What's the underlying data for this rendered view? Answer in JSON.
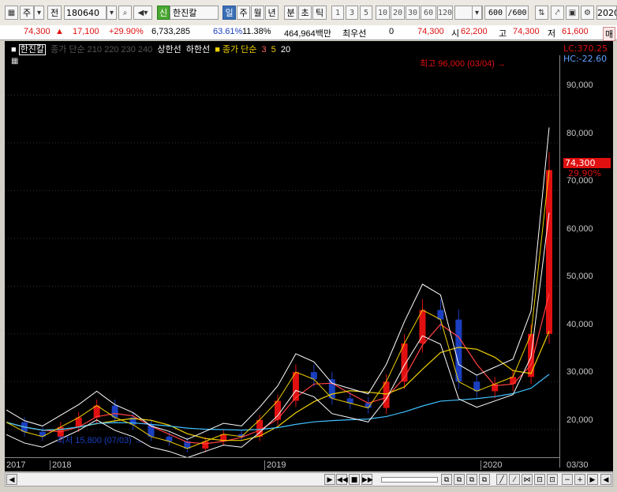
{
  "toolbar": {
    "type_label": "주",
    "jeon_label": "전",
    "code": "180640",
    "market_badge": "신",
    "stock_name": "한진칼",
    "periods": [
      "일",
      "주",
      "월",
      "년",
      "분",
      "초",
      "틱"
    ],
    "active_period": "일",
    "intervals": [
      "1",
      "3",
      "5",
      "10",
      "20",
      "30",
      "60",
      "120"
    ],
    "count_value": "600",
    "count_total": "/600",
    "year_field": "2020",
    "icons": [
      "grid-icon",
      "search-icon",
      "speaker-icon",
      "dropdown-icon",
      "settings-icon",
      "save-icon",
      "table-icon"
    ]
  },
  "quote": {
    "price": "74,300",
    "change": "17,100",
    "change_pct": "+29.90%",
    "volume": "6,733,285",
    "vol_ratio": "63.61%",
    "turnover": "11.38%",
    "amount": "464,964백만",
    "kind": "최우선",
    "kind_value": "0",
    "bid": "74,300",
    "open_label": "시",
    "open_value": "62,200",
    "high_label": "고",
    "high_value": "74,300",
    "low_label": "저",
    "low_value": "61,600",
    "trade_label": "매"
  },
  "legend": {
    "name": "한진칼",
    "ma_gray": "종가 단순 210 220 230 240",
    "upper": "상한선",
    "lower": "하한선",
    "ma_yel_label": "종가 단순",
    "ma3": "3",
    "ma5": "5",
    "ma20": "20"
  },
  "annotations": {
    "high": "최고 96,000 (03/04)",
    "low": "최저 15,800 (07/03)",
    "lc": "LC:370.25",
    "hc": "HC:-22.60",
    "last_price": "74,300",
    "last_pct": "29.90%"
  },
  "y_axis": {
    "labels": [
      "90,000",
      "80,000",
      "70,000",
      "60,000",
      "50,000",
      "40,000",
      "30,000",
      "20,000"
    ]
  },
  "x_axis": {
    "labels": [
      "2017",
      "2018",
      "2019",
      "2020",
      "03/30"
    ]
  },
  "colors": {
    "up": "#e01010",
    "down": "#1a3fc0",
    "envelope": "#ffffff",
    "ma3": "#ff4040",
    "ma5": "#f0d000",
    "ma20": "#40c0ff"
  },
  "chart_data": {
    "type": "line",
    "title": "",
    "x": [
      "2017-09",
      "2017-10",
      "2017-11",
      "2017-12",
      "2018-01",
      "2018-02",
      "2018-03",
      "2018-04",
      "2018-05",
      "2018-06",
      "2018-07",
      "2018-08",
      "2018-09",
      "2018-10",
      "2018-11",
      "2018-12",
      "2019-01",
      "2019-02",
      "2019-03",
      "2019-04",
      "2019-05",
      "2019-06",
      "2019-07",
      "2019-08",
      "2019-09",
      "2019-10",
      "2019-11",
      "2019-12",
      "2020-01",
      "2020-02",
      "2020-03"
    ],
    "series": [
      {
        "values": [
          21500,
          19500,
          18500,
          20500,
          22500,
          25000,
          22500,
          21000,
          18500,
          17500,
          16000,
          17500,
          19000,
          18500,
          22000,
          26000,
          32000,
          30500,
          26500,
          25500,
          24500,
          30000,
          38000,
          45000,
          43000,
          30000,
          28000,
          29500,
          31000,
          40000,
          74300
        ]
      }
    ],
    "ylim": [
      15000,
      98000
    ]
  }
}
